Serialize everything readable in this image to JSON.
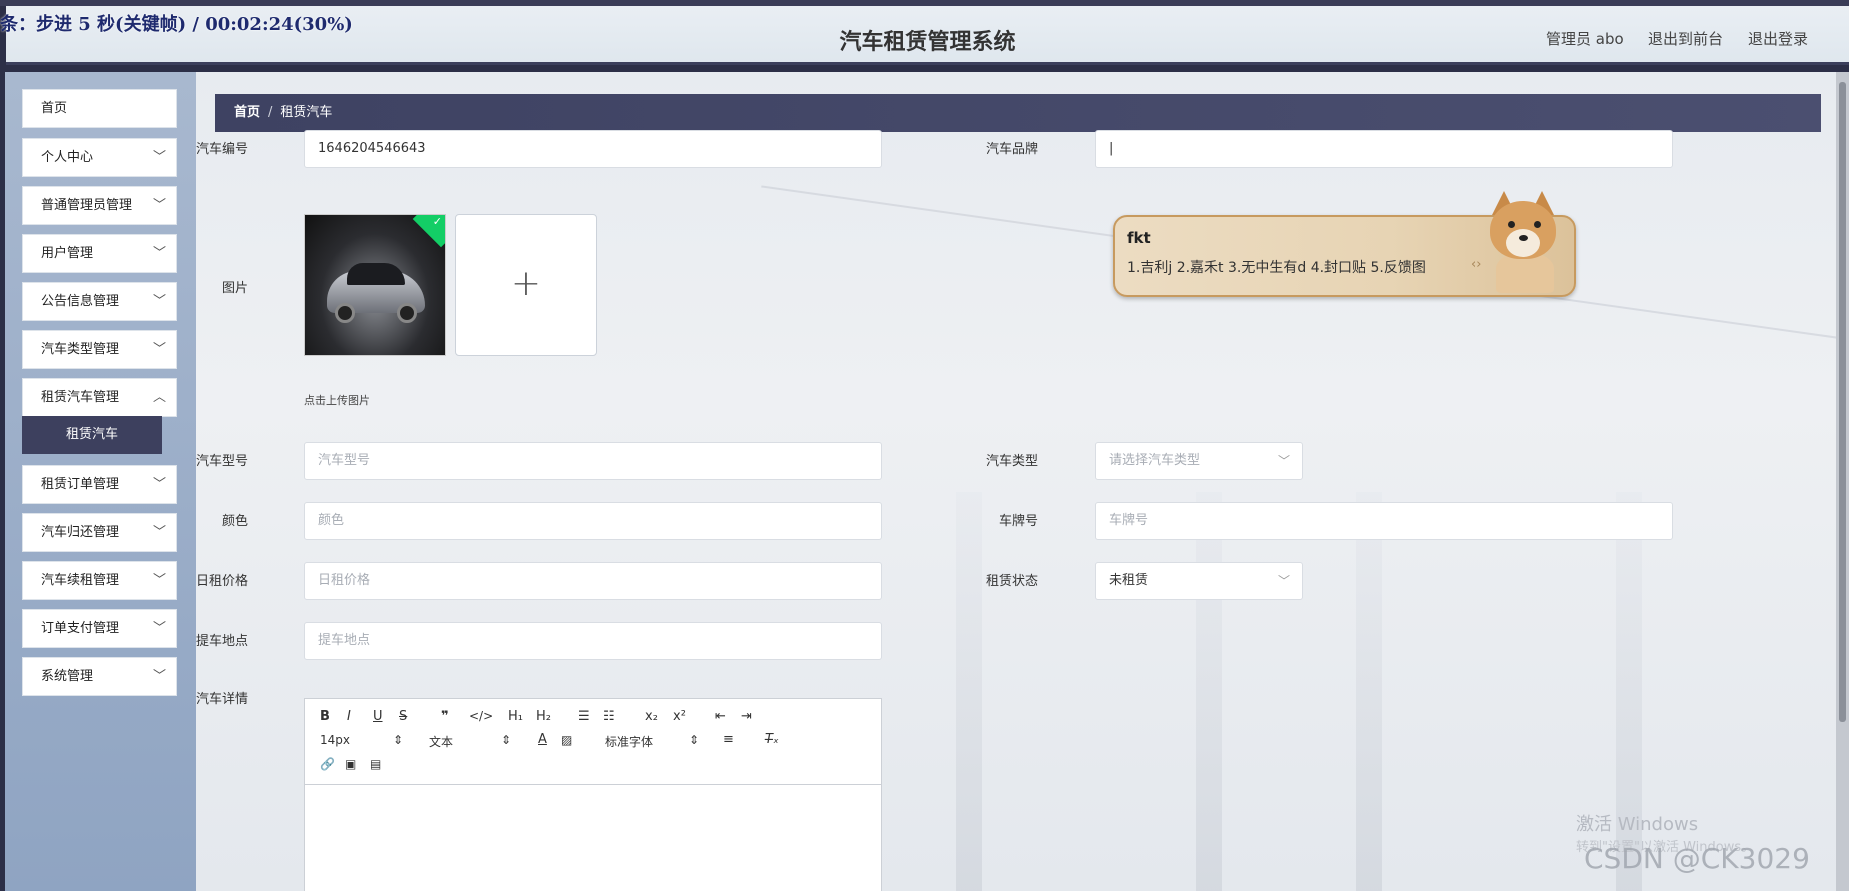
{
  "video_overlay": "条：步进 5 秒(关键帧) / 00:02:24(30%)",
  "header": {
    "title": "汽车租赁管理系统",
    "user": "管理员 abo",
    "to_front": "退出到前台",
    "logout": "退出登录"
  },
  "sidebar": {
    "items": [
      {
        "label": "首页"
      },
      {
        "label": "个人中心"
      },
      {
        "label": "普通管理员管理"
      },
      {
        "label": "用户管理"
      },
      {
        "label": "公告信息管理"
      },
      {
        "label": "汽车类型管理"
      },
      {
        "label": "租赁汽车管理"
      },
      {
        "label": "租赁订单管理"
      },
      {
        "label": "汽车归还管理"
      },
      {
        "label": "汽车续租管理"
      },
      {
        "label": "订单支付管理"
      },
      {
        "label": "系统管理"
      }
    ],
    "active_sub": "租赁汽车"
  },
  "breadcrumb": {
    "home": "首页",
    "separator": "/",
    "current": "租赁汽车"
  },
  "form": {
    "car_no_label": "汽车编号",
    "car_no_value": "1646204546643",
    "brand_label": "汽车品牌",
    "brand_value": "",
    "image_label": "图片",
    "upload_hint": "点击上传图片",
    "model_label": "汽车型号",
    "model_placeholder": "汽车型号",
    "type_label": "汽车类型",
    "type_placeholder": "请选择汽车类型",
    "color_label": "颜色",
    "color_placeholder": "颜色",
    "plate_label": "车牌号",
    "plate_placeholder": "车牌号",
    "price_label": "日租价格",
    "price_placeholder": "日租价格",
    "status_label": "租赁状态",
    "status_value": "未租赁",
    "pickup_label": "提车地点",
    "pickup_placeholder": "提车地点",
    "detail_label": "汽车详情"
  },
  "editor": {
    "font_size": "14px",
    "block_format": "文本",
    "font_family": "标准字体"
  },
  "ime": {
    "typed": "fkt",
    "candidates": "1.吉利j  2.嘉禾t  3.无中生有d  4.封口贴  5.反馈图"
  },
  "watermark": {
    "activate": "激活 Windows",
    "activate_sub": "转到\"设置\"以激活 Windows。",
    "csdn": "CSDN @CK3029"
  }
}
